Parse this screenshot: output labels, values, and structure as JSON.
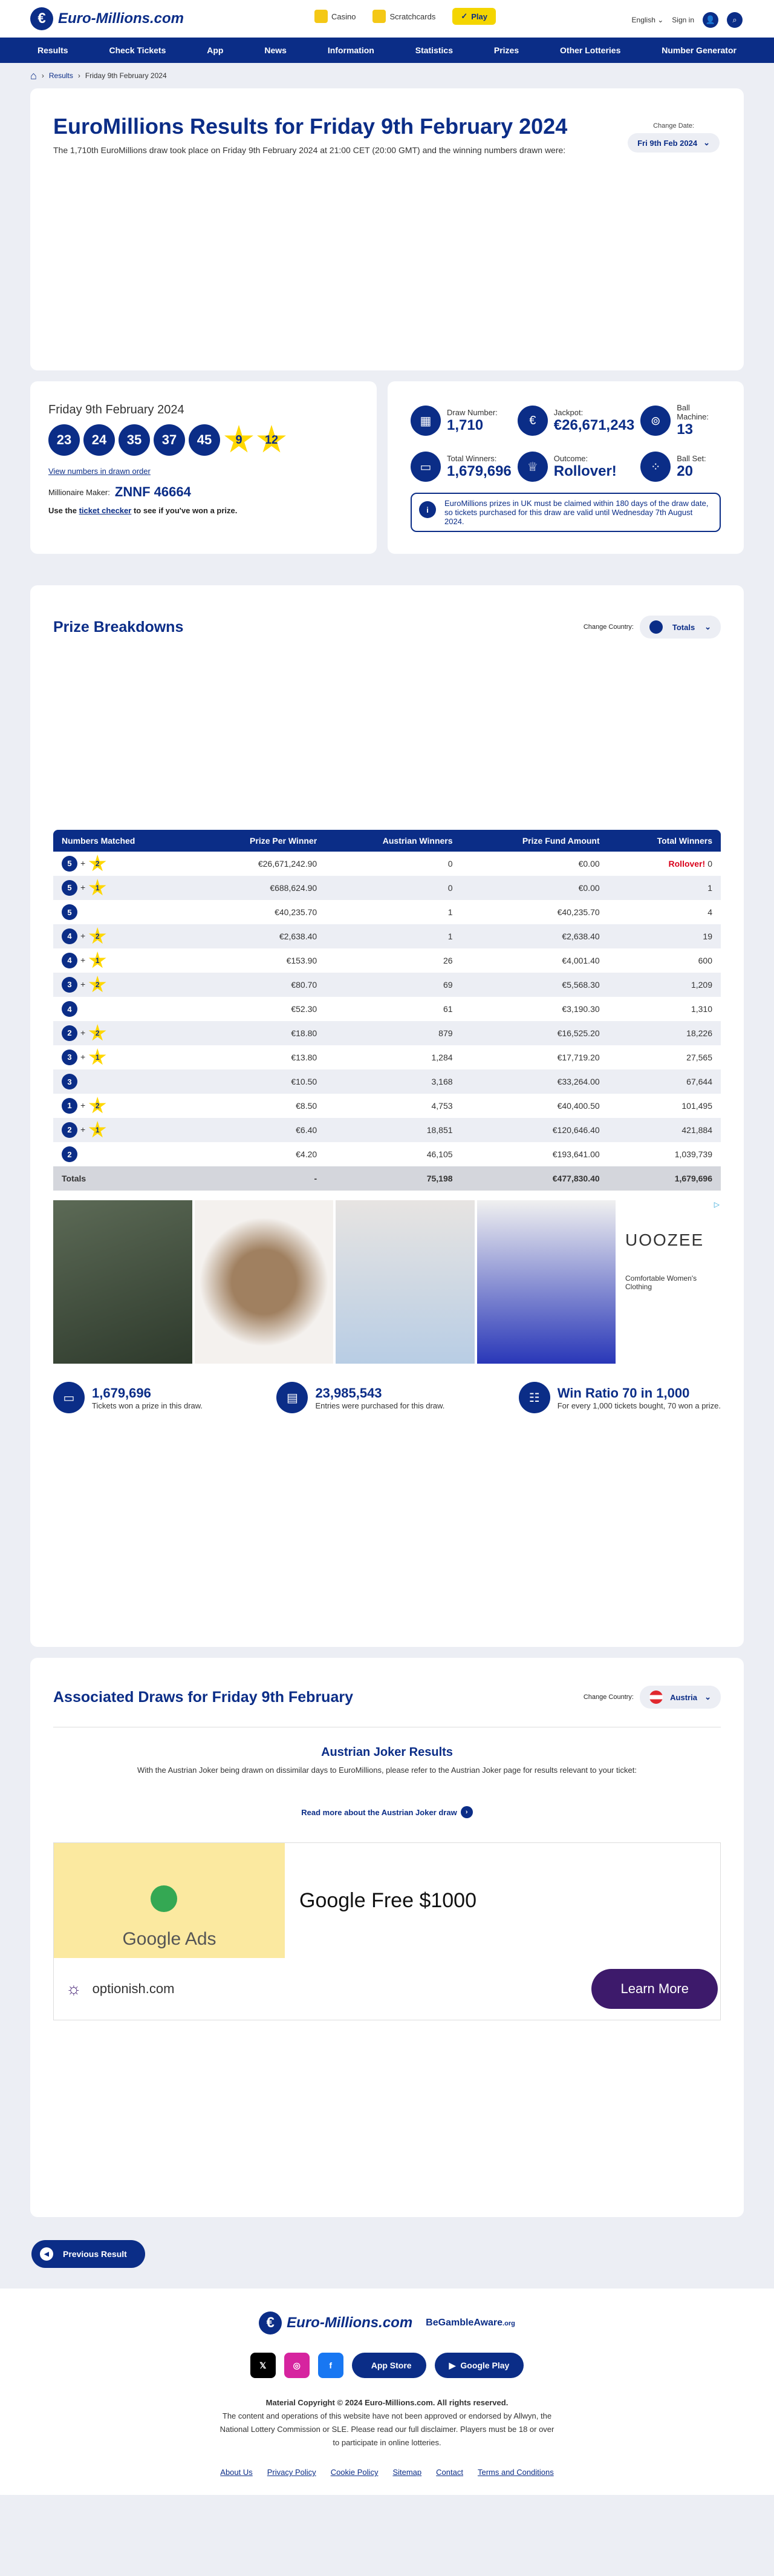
{
  "header": {
    "logo": "Euro-Millions.com",
    "casino": "Casino",
    "scratchcards": "Scratchcards",
    "play": "Play",
    "language": "English",
    "signin": "Sign in"
  },
  "nav": [
    "Results",
    "Check Tickets",
    "App",
    "News",
    "Information",
    "Statistics",
    "Prizes",
    "Other Lotteries",
    "Number Generator"
  ],
  "breadcrumb": [
    "Results",
    "Friday 9th February 2024"
  ],
  "page": {
    "title": "EuroMillions Results for Friday 9th February 2024",
    "intro": "The 1,710th EuroMillions draw took place on Friday 9th February 2024 at 21:00 CET (20:00 GMT) and the winning numbers drawn were:",
    "change_date_label": "Change Date:",
    "change_date_value": "Fri 9th Feb 2024"
  },
  "draw": {
    "date": "Friday 9th February 2024",
    "balls": [
      "23",
      "24",
      "35",
      "37",
      "45"
    ],
    "stars": [
      "9",
      "12"
    ],
    "drawn_order_link": "View numbers in drawn order",
    "millionaire_label": "Millionaire Maker:",
    "millionaire_code": "ZNNF 46664",
    "checker_pre": "Use the",
    "checker_link": "ticket checker",
    "checker_post": "to see if you've won a prize."
  },
  "stats": {
    "draw_number_label": "Draw Number:",
    "draw_number": "1,710",
    "jackpot_label": "Jackpot:",
    "jackpot": "€26,671,243",
    "ball_machine_label": "Ball Machine:",
    "ball_machine": "13",
    "total_winners_label": "Total Winners:",
    "total_winners": "1,679,696",
    "outcome_label": "Outcome:",
    "outcome": "Rollover!",
    "ball_set_label": "Ball Set:",
    "ball_set": "20",
    "note": "EuroMillions prizes in UK must be claimed within 180 days of the draw date, so tickets purchased for this draw are valid until Wednesday 7th August 2024."
  },
  "prizes": {
    "title": "Prize Breakdowns",
    "country_label": "Change Country:",
    "country_value": "Totals",
    "headers": [
      "Numbers Matched",
      "Prize Per Winner",
      "Austrian Winners",
      "Prize Fund Amount",
      "Total Winners"
    ],
    "rows": [
      {
        "b": "5",
        "s": "2",
        "ppw": "€26,671,242.90",
        "aw": "0",
        "pfa": "€0.00",
        "tw_pre": "Rollover!",
        "tw": "0"
      },
      {
        "b": "5",
        "s": "1",
        "ppw": "€688,624.90",
        "aw": "0",
        "pfa": "€0.00",
        "tw": "1"
      },
      {
        "b": "5",
        "s": "",
        "ppw": "€40,235.70",
        "aw": "1",
        "pfa": "€40,235.70",
        "tw": "4"
      },
      {
        "b": "4",
        "s": "2",
        "ppw": "€2,638.40",
        "aw": "1",
        "pfa": "€2,638.40",
        "tw": "19"
      },
      {
        "b": "4",
        "s": "1",
        "ppw": "€153.90",
        "aw": "26",
        "pfa": "€4,001.40",
        "tw": "600"
      },
      {
        "b": "3",
        "s": "2",
        "ppw": "€80.70",
        "aw": "69",
        "pfa": "€5,568.30",
        "tw": "1,209"
      },
      {
        "b": "4",
        "s": "",
        "ppw": "€52.30",
        "aw": "61",
        "pfa": "€3,190.30",
        "tw": "1,310"
      },
      {
        "b": "2",
        "s": "2",
        "ppw": "€18.80",
        "aw": "879",
        "pfa": "€16,525.20",
        "tw": "18,226"
      },
      {
        "b": "3",
        "s": "1",
        "ppw": "€13.80",
        "aw": "1,284",
        "pfa": "€17,719.20",
        "tw": "27,565"
      },
      {
        "b": "3",
        "s": "",
        "ppw": "€10.50",
        "aw": "3,168",
        "pfa": "€33,264.00",
        "tw": "67,644"
      },
      {
        "b": "1",
        "s": "2",
        "ppw": "€8.50",
        "aw": "4,753",
        "pfa": "€40,400.50",
        "tw": "101,495"
      },
      {
        "b": "2",
        "s": "1",
        "ppw": "€6.40",
        "aw": "18,851",
        "pfa": "€120,646.40",
        "tw": "421,884"
      },
      {
        "b": "2",
        "s": "",
        "ppw": "€4.20",
        "aw": "46,105",
        "pfa": "€193,641.00",
        "tw": "1,039,739"
      }
    ],
    "totals": [
      "Totals",
      "-",
      "75,198",
      "€477,830.40",
      "1,679,696"
    ],
    "ad_brand": "UOOZEE",
    "ad_caption": "Comfortable Women's Clothing",
    "summary": [
      {
        "value": "1,679,696",
        "label": "Tickets won a prize in this draw."
      },
      {
        "value": "23,985,543",
        "label": "Entries were purchased for this draw."
      },
      {
        "value": "Win Ratio 70 in 1,000",
        "label": "For every 1,000 tickets bought, 70 won a prize."
      }
    ]
  },
  "associated": {
    "title": "Associated Draws for Friday 9th February",
    "country_label": "Change Country:",
    "country_value": "Austria",
    "sub_title": "Austrian Joker Results",
    "text": "With the Austrian Joker being drawn on dissimilar days to EuroMillions, please refer to the Austrian Joker page for results relevant to your ticket:",
    "link": "Read more about the Austrian Joker draw",
    "ad_headline": "Google Free $1000",
    "ad_brand": "Google Ads",
    "ad_domain": "optionish.com",
    "ad_cta": "Learn More"
  },
  "prev_button": "Previous Result",
  "footer": {
    "logo": "Euro-Millions.com",
    "gamble": "BeGambleAware",
    "gamble_suffix": ".org",
    "app_store": "App Store",
    "google_play": "Google Play",
    "copyright": "Material Copyright © 2024 Euro-Millions.com. All rights reserved.",
    "disclaimer": "The content and operations of this website have not been approved or endorsed by Allwyn, the National Lottery Commission or SLE. Please read our full disclaimer. Players must be 18 or over to participate in online lotteries.",
    "links": [
      "About Us",
      "Privacy Policy",
      "Cookie Policy",
      "Sitemap",
      "Contact",
      "Terms and Conditions"
    ]
  },
  "colors": {
    "brand": "#0b2d87",
    "star": "#ffd700",
    "rollover": "#d9001b"
  }
}
